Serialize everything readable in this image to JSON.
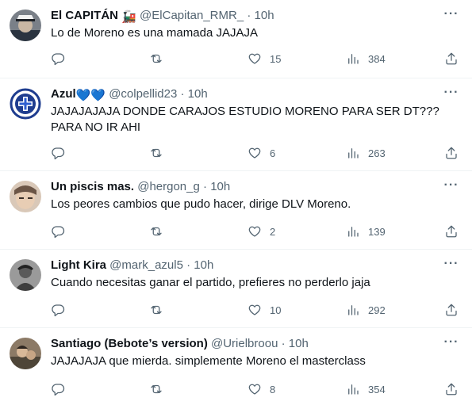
{
  "tweets": [
    {
      "name": "El CAPITÁN",
      "name_emoji": "🚂",
      "handle": "@ElCapitan_RMR_",
      "dot": "·",
      "time": "10h",
      "text": "Lo de Moreno es una mamada JAJAJA",
      "replies": "",
      "retweets": "",
      "likes": "15",
      "views": "384"
    },
    {
      "name": "Azul",
      "name_emoji": "💙💙",
      "handle": "@colpellid23",
      "dot": "·",
      "time": "10h",
      "text": "JAJAJAJAJA DONDE CARAJOS ESTUDIO MORENO PARA SER DT??? PARA NO IR AHI",
      "replies": "",
      "retweets": "",
      "likes": "6",
      "views": "263"
    },
    {
      "name": "Un piscis mas.",
      "name_emoji": "",
      "handle": "@hergon_g",
      "dot": "·",
      "time": "10h",
      "text": "Los peores cambios que pudo hacer, dirige DLV Moreno.",
      "replies": "",
      "retweets": "",
      "likes": "2",
      "views": "139"
    },
    {
      "name": "Light Kira",
      "name_emoji": "",
      "handle": "@mark_azul5",
      "dot": "·",
      "time": "10h",
      "text": "Cuando necesitas ganar el partido, prefieres no perderlo jaja",
      "replies": "",
      "retweets": "",
      "likes": "10",
      "views": "292"
    },
    {
      "name": "Santiago (Bebote’s version)",
      "name_emoji": "",
      "handle": "@Urielbroou",
      "dot": "·",
      "time": "10h",
      "text": "JAJAJAJA que mierda. simplemente Moreno el masterclass",
      "replies": "",
      "retweets": "",
      "likes": "8",
      "views": "354"
    }
  ],
  "colors": {
    "text": "#0f1419",
    "secondary": "#536471",
    "divider": "#eff3f4",
    "heart_blue": "#5aaef0"
  },
  "icons": [
    "reply-icon",
    "retweet-icon",
    "like-icon",
    "views-icon",
    "share-icon",
    "more-options-icon"
  ]
}
